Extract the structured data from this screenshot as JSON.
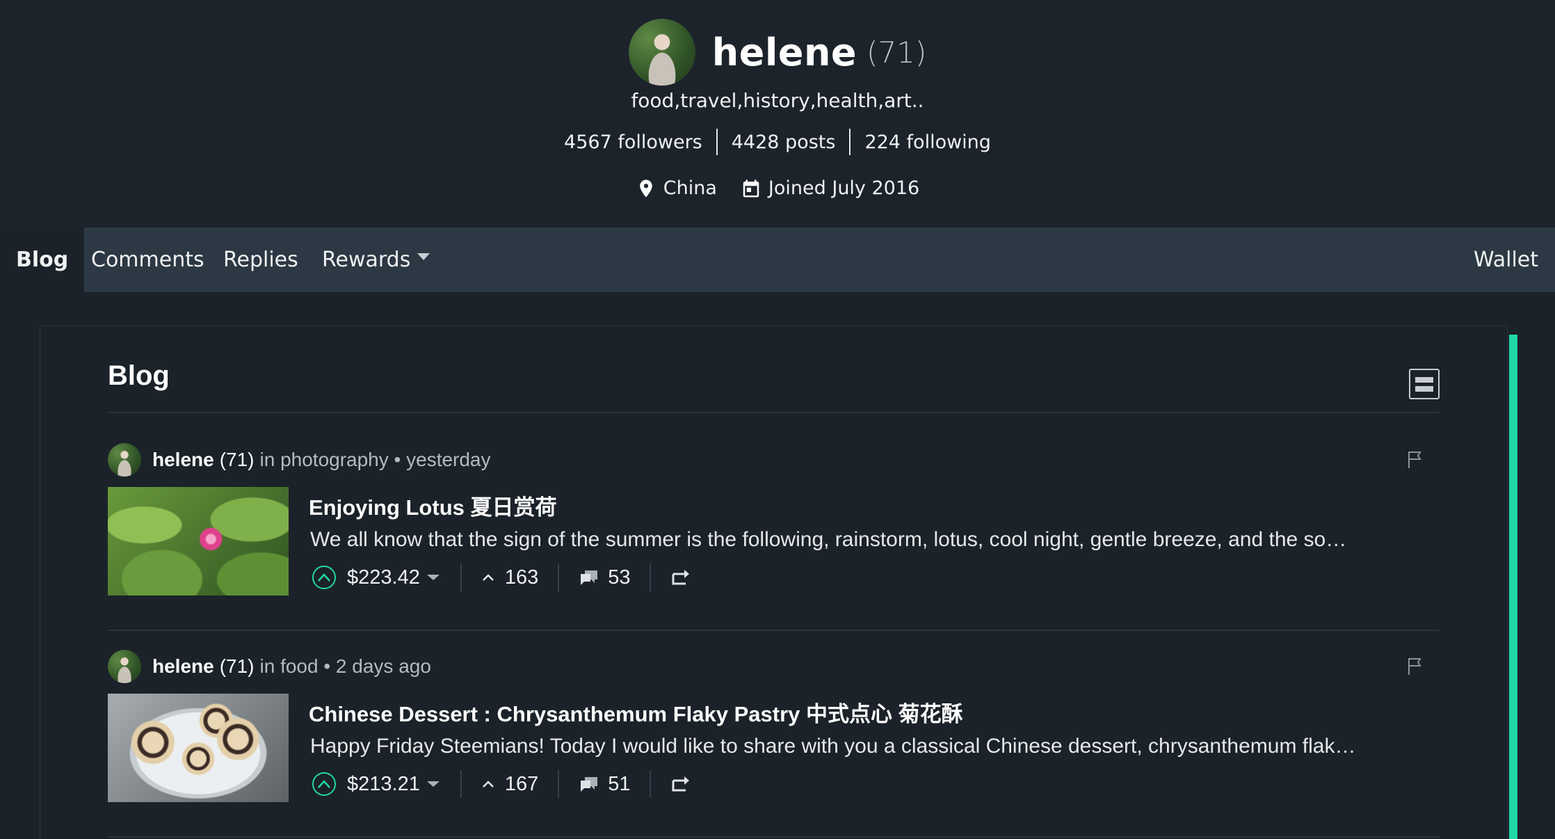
{
  "profile": {
    "name": "helene",
    "reputation": "(71)",
    "about": "food,travel,history,health,art..",
    "followers": "4567 followers",
    "posts": "4428 posts",
    "following": "224 following",
    "location": "China",
    "joined": "Joined July 2016"
  },
  "nav": {
    "tabs": [
      "Blog",
      "Comments",
      "Replies",
      "Rewards"
    ],
    "active": "Blog",
    "wallet": "Wallet"
  },
  "blog": {
    "heading": "Blog",
    "posts": [
      {
        "author": "helene",
        "reputation": "(71)",
        "meta": "in photography • yesterday",
        "title": "Enjoying Lotus 夏日赏荷",
        "excerpt": "We all know that the sign of the summer is the following, rainstorm, lotus, cool night, gentle breeze, and the so…",
        "payout": "$223.42",
        "votes": "163",
        "comments": "53",
        "thumbnail": "lotus"
      },
      {
        "author": "helene",
        "reputation": "(71)",
        "meta": "in food • 2 days ago",
        "title": "Chinese Dessert : Chrysanthemum Flaky Pastry 中式点心 菊花酥",
        "excerpt": "Happy Friday Steemians! Today I would like to share with you a classical Chinese dessert, chrysanthemum flak…",
        "payout": "$213.21",
        "votes": "167",
        "comments": "51",
        "thumbnail": "pastry"
      }
    ]
  },
  "colors": {
    "background": "#1b2229",
    "nav_background": "#2c3843",
    "accent": "#1fd8a6"
  },
  "icons": [
    "location-pin-icon",
    "calendar-icon",
    "chevron-down-icon",
    "layout-toggle-icon",
    "flag-icon",
    "upvote-icon",
    "caret-down-icon",
    "chevron-up-icon",
    "comments-icon",
    "reblog-icon"
  ]
}
